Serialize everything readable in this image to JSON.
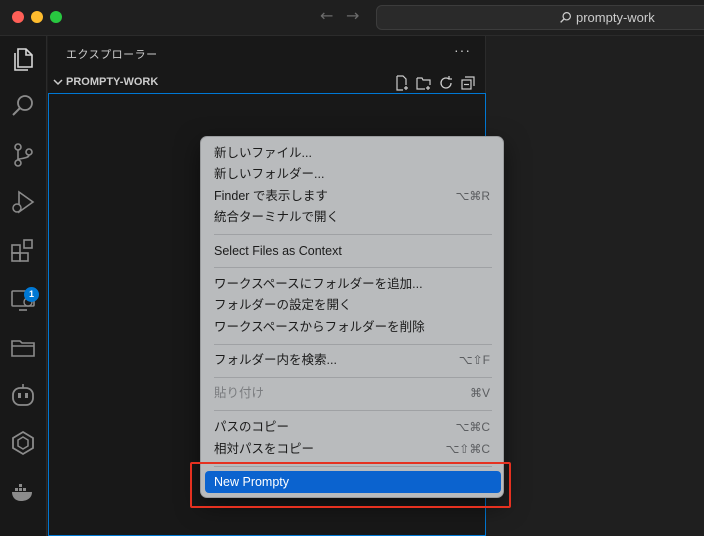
{
  "titlebar": {
    "search_text": "prompty-work"
  },
  "activity_bar": {
    "items": [
      {
        "name": "explorer",
        "icon": "files-icon"
      },
      {
        "name": "search",
        "icon": "search-icon"
      },
      {
        "name": "source-control",
        "icon": "source-control-icon"
      },
      {
        "name": "run-debug",
        "icon": "run-debug-icon"
      },
      {
        "name": "extensions",
        "icon": "extensions-icon",
        "badge": "1"
      },
      {
        "name": "remote-explorer",
        "icon": "remote-explorer-icon"
      },
      {
        "name": "project-manager",
        "icon": "folders-icon"
      },
      {
        "name": "copilot",
        "icon": "robot-icon"
      },
      {
        "name": "ai-studio",
        "icon": "hexagon-icon"
      },
      {
        "name": "docker",
        "icon": "docker-icon"
      }
    ]
  },
  "sidebar": {
    "title": "エクスプローラー",
    "more": "···",
    "section_title": "PROMPTY-WORK"
  },
  "context_menu": {
    "items": [
      {
        "label": "新しいファイル...",
        "shortcut": ""
      },
      {
        "label": "新しいフォルダー...",
        "shortcut": ""
      },
      {
        "label": "Finder で表示します",
        "shortcut": "⌥⌘R"
      },
      {
        "label": "統合ターミナルで開く",
        "shortcut": ""
      },
      {
        "label": "Select Files as Context",
        "shortcut": ""
      },
      {
        "label": "ワークスペースにフォルダーを追加...",
        "shortcut": ""
      },
      {
        "label": "フォルダーの設定を開く",
        "shortcut": ""
      },
      {
        "label": "ワークスペースからフォルダーを削除",
        "shortcut": ""
      },
      {
        "label": "フォルダー内を検索...",
        "shortcut": "⌥⇧F"
      },
      {
        "label": "貼り付け",
        "shortcut": "⌘V",
        "disabled": true
      },
      {
        "label": "パスのコピー",
        "shortcut": "⌥⌘C"
      },
      {
        "label": "相対パスをコピー",
        "shortcut": "⌥⇧⌘C"
      },
      {
        "label": "New Prompty",
        "shortcut": "",
        "highlighted": true
      }
    ]
  },
  "colors": {
    "accent": "#0078d4",
    "menu_highlight": "#0b63cf",
    "annotation_red": "#e53120"
  }
}
